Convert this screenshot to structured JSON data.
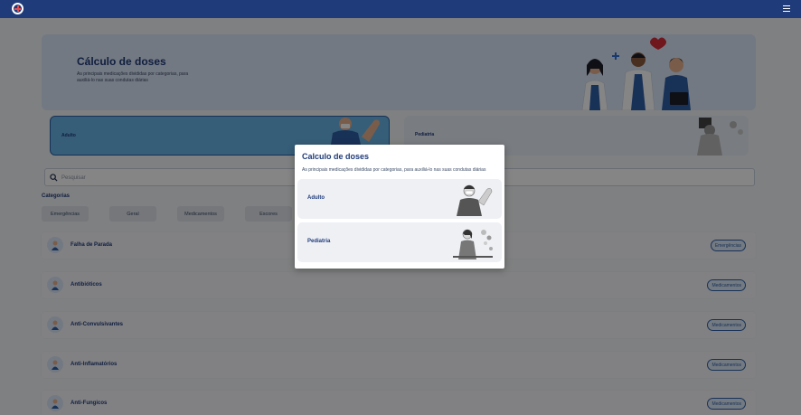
{
  "header": {
    "logo_icon": "medical-cross-logo",
    "menu_icon": "hamburger-icon"
  },
  "hero": {
    "title": "Cálculo de doses",
    "subtitle": "As principais medicações divididas por categorias, para auxiliá-lo nas suas condutas diárias"
  },
  "categories_cards": {
    "adulto": "Adulto",
    "pediatria": "Pediatria"
  },
  "search": {
    "placeholder": "Pesquisar"
  },
  "filters": {
    "title": "Categorias",
    "chips": [
      "Emergências",
      "Geral",
      "Medicamentos",
      "Escores"
    ]
  },
  "list": [
    {
      "name": "Falha de Parada",
      "badge": "Emergências"
    },
    {
      "name": "Antibióticos",
      "badge": "Medicamentos"
    },
    {
      "name": "Anti-Convulsivantes",
      "badge": "Medicamentos"
    },
    {
      "name": "Anti-Inflamatórios",
      "badge": "Medicamentos"
    },
    {
      "name": "Anti-Fungicos",
      "badge": "Medicamentos"
    }
  ],
  "modal": {
    "title": "Calculo de doses",
    "subtitle": "As principais medicações divididas por categorias, para auxiliá-lo nas suas condutas diárias",
    "options": [
      "Adulto",
      "Pediatria"
    ]
  },
  "colors": {
    "primary": "#1f3b7a",
    "accent": "#2e5fa8",
    "hero_bg": "#dce8fa",
    "adult_card": "#69b4e6"
  }
}
